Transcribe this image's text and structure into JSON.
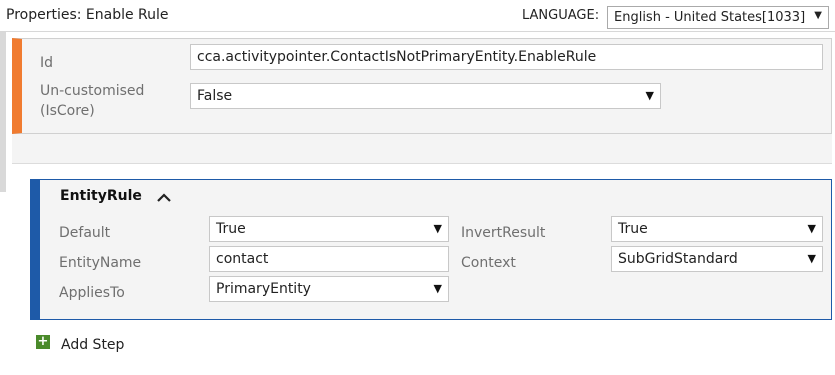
{
  "header": {
    "title": "Properties: Enable Rule",
    "language_label": "LANGUAGE:",
    "language_value": "English - United States[1033]"
  },
  "properties": {
    "id_label": "Id",
    "id_value": "cca.activitypointer.ContactIsNotPrimaryEntity.EnableRule",
    "iscore_label_line1": "Un-customised",
    "iscore_label_line2": "(IsCore)",
    "iscore_value": "False"
  },
  "entity_rule": {
    "title": "EntityRule",
    "default_label": "Default",
    "default_value": "True",
    "entityname_label": "EntityName",
    "entityname_value": "contact",
    "appliesto_label": "AppliesTo",
    "appliesto_value": "PrimaryEntity",
    "invertresult_label": "InvertResult",
    "invertresult_value": "True",
    "context_label": "Context",
    "context_value": "SubGridStandard"
  },
  "actions": {
    "add_step_label": "Add Step"
  },
  "colors": {
    "orange_accent": "#f07b30",
    "blue_accent": "#1e5aa8",
    "add_green": "#4a8a2a"
  }
}
